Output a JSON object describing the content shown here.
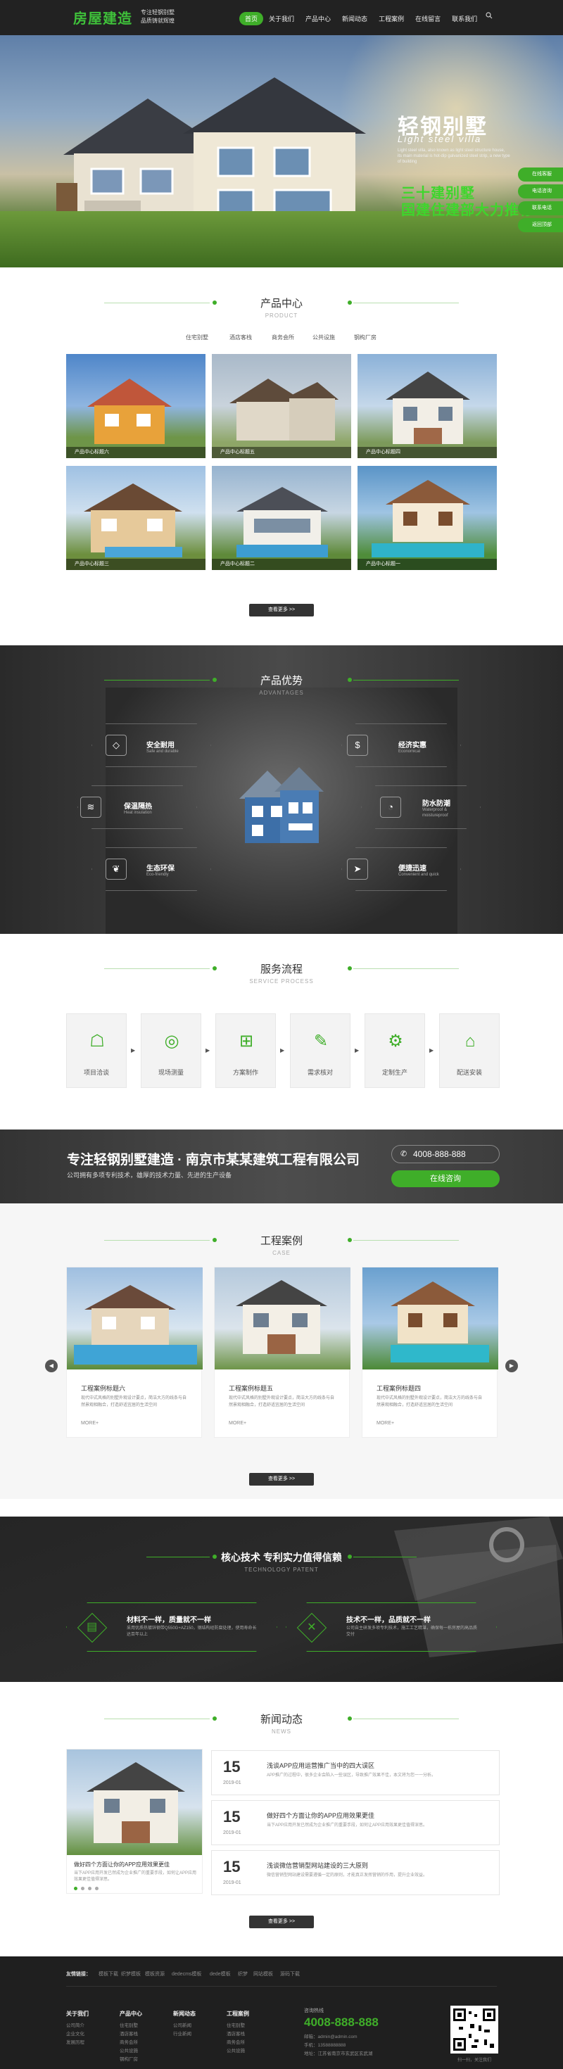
{
  "header": {
    "logo": "房屋建造",
    "logo_sub1": "专注轻钢别墅",
    "logo_sub2": "品质铸就辉煌",
    "nav": [
      "首页",
      "关于我们",
      "产品中心",
      "新闻动态",
      "工程案例",
      "在线留言",
      "联系我们"
    ]
  },
  "hero": {
    "title": "轻钢别墅",
    "subtitle_en": "Light steel villa",
    "desc": "Light steel villa, also known as light steel structure house, its main material is hot-dip galvanized steel strip, a new type of building",
    "slogan1": "三十建别墅",
    "slogan2": "国建住建部大力推荐"
  },
  "side_float": [
    "在线客服",
    "电话咨询",
    "联系电话",
    "返回顶部"
  ],
  "product": {
    "title": "产品中心",
    "subtitle": "PRODUCT",
    "tabs": [
      "住宅别墅",
      "酒店客栈",
      "商务会所",
      "公共设施",
      "钢构厂房"
    ],
    "items": [
      "产品中心标题六",
      "产品中心标题五",
      "产品中心标题四",
      "产品中心标题三",
      "产品中心标题二",
      "产品中心标题一"
    ],
    "more": "查看更多 >>"
  },
  "advantages": {
    "title": "产品优势",
    "subtitle": "ADVANTAGES",
    "items": [
      {
        "title": "安全耐用",
        "sub": "Safe and durable"
      },
      {
        "title": "保温隔热",
        "sub": "Heat insulation"
      },
      {
        "title": "生态环保",
        "sub": "Eco-friendly"
      },
      {
        "title": "经济实惠",
        "sub": "Economical"
      },
      {
        "title": "防水防潮",
        "sub": "Waterproof & moistureproof"
      },
      {
        "title": "便捷迅速",
        "sub": "Convenient and quick"
      }
    ]
  },
  "service": {
    "title": "服务流程",
    "subtitle": "SERVICE PROCESS",
    "steps": [
      "项目洽谈",
      "现场测量",
      "方案制作",
      "需求核对",
      "定制生产",
      "配送安装"
    ]
  },
  "banner": {
    "title": "专注轻钢别墅建造 · 南京市某某建筑工程有限公司",
    "sub": "公司拥有多项专利技术，雄厚的技术力量、先进的生产设备",
    "phone": "4008-888-888",
    "btn": "在线咨询"
  },
  "cases": {
    "title": "工程案例",
    "subtitle": "CASE",
    "items": [
      {
        "title": "工程案例标题六",
        "desc": "现代中式风格的别墅外观设计要点，简洁大方的线条与自然景观相融合，打造舒适宜居的生活空间"
      },
      {
        "title": "工程案例标题五",
        "desc": "现代中式风格的别墅外观设计要点，简洁大方的线条与自然景观相融合，打造舒适宜居的生活空间"
      },
      {
        "title": "工程案例标题四",
        "desc": "现代中式风格的别墅外观设计要点，简洁大方的线条与自然景观相融合，打造舒适宜居的生活空间"
      }
    ],
    "more": "MORE+",
    "view_more": "查看更多 >>"
  },
  "patent": {
    "title": "核心技术 专利实力值得信赖",
    "subtitle": "TECHNOLOGY PATENT",
    "items": [
      {
        "title": "材料不一样，质量就不一样",
        "desc": "采用优质热镀锌钢带Q550G+AZ150，钢结构经防腐处理，使用寿命长达百年以上"
      },
      {
        "title": "技术不一样，品质就不一样",
        "desc": "公司自主研发多项专利技术，施工工艺精湛，确保每一栋房屋的高品质交付"
      }
    ]
  },
  "news": {
    "title": "新闻动态",
    "subtitle": "NEWS",
    "featured_title": "做好四个方面让你的APP应用效果更佳",
    "featured_desc": "当下APP应用开发已然成为企业推广的重要手段，如何让APP应用效果更佳值得深思。",
    "items": [
      {
        "day": "15",
        "date": "2019-01",
        "title": "浅谈APP应用运营推广当中的四大误区",
        "desc": "APP推广的过程中，很多企业会陷入一些误区，导致推广效果不佳，本文将为您一一分析。"
      },
      {
        "day": "15",
        "date": "2019-01",
        "title": "做好四个方面让你的APP应用效果更佳",
        "desc": "当下APP应用开发已然成为企业推广的重要手段，如何让APP应用效果更佳值得深思。"
      },
      {
        "day": "15",
        "date": "2019-01",
        "title": "浅谈微信营销型网站建设的三大原则",
        "desc": "微信营销型网站建设需要遵循一定的原则，才能真正发挥营销的作用，提升企业效益。"
      }
    ],
    "more": "查看更多 >>"
  },
  "footer": {
    "links_label": "友情链接：",
    "links": [
      "模板下载",
      "织梦模板",
      "模板资源",
      "dedecms模板",
      "dede模板",
      "织梦",
      "网站模板",
      "源码下载"
    ],
    "cols": [
      {
        "title": "关于我们",
        "items": [
          "公司简介",
          "企业文化",
          "发展历程"
        ]
      },
      {
        "title": "产品中心",
        "items": [
          "住宅别墅",
          "酒店客栈",
          "商务会所",
          "公共设施",
          "钢构厂房"
        ]
      },
      {
        "title": "新闻动态",
        "items": [
          "公司新闻",
          "行业新闻"
        ]
      },
      {
        "title": "工程案例",
        "items": [
          "住宅别墅",
          "酒店客栈",
          "商务会所",
          "公共设施"
        ]
      }
    ],
    "phone_label": "咨询热线",
    "phone": "4008-888-888",
    "contact": [
      "邮箱：admin@admin.com",
      "手机：13588888888",
      "地址：江苏省南京市玄武区玄武湖"
    ],
    "qr_label": "扫一扫，关注我们"
  }
}
